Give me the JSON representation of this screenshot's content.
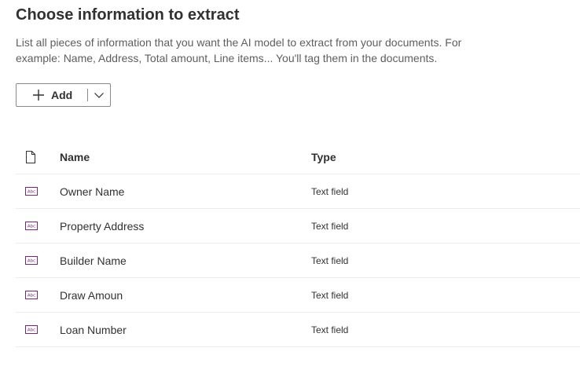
{
  "header": {
    "title": "Choose information to extract",
    "description": "List all pieces of information that you want the AI model to extract from your documents. For example: Name, Address, Total amount, Line items... You'll tag them in the documents."
  },
  "toolbar": {
    "add_label": "Add",
    "add_icon": "plus-icon",
    "dropdown_icon": "chevron-down-icon"
  },
  "table": {
    "columns": {
      "icon": "document-icon",
      "name": "Name",
      "type": "Type"
    },
    "rows": [
      {
        "icon": "text-field-icon",
        "name": "Owner Name",
        "type": "Text field"
      },
      {
        "icon": "text-field-icon",
        "name": "Property Address",
        "type": "Text field"
      },
      {
        "icon": "text-field-icon",
        "name": "Builder Name",
        "type": "Text field"
      },
      {
        "icon": "text-field-icon",
        "name": "Draw Amoun",
        "type": "Text field"
      },
      {
        "icon": "text-field-icon",
        "name": "Loan Number",
        "type": "Text field"
      }
    ]
  },
  "colors": {
    "text_field_icon": "#742774",
    "border": "#edebe9",
    "button_border": "#8a8886",
    "text_primary": "#323130",
    "text_secondary": "#605e5c"
  }
}
